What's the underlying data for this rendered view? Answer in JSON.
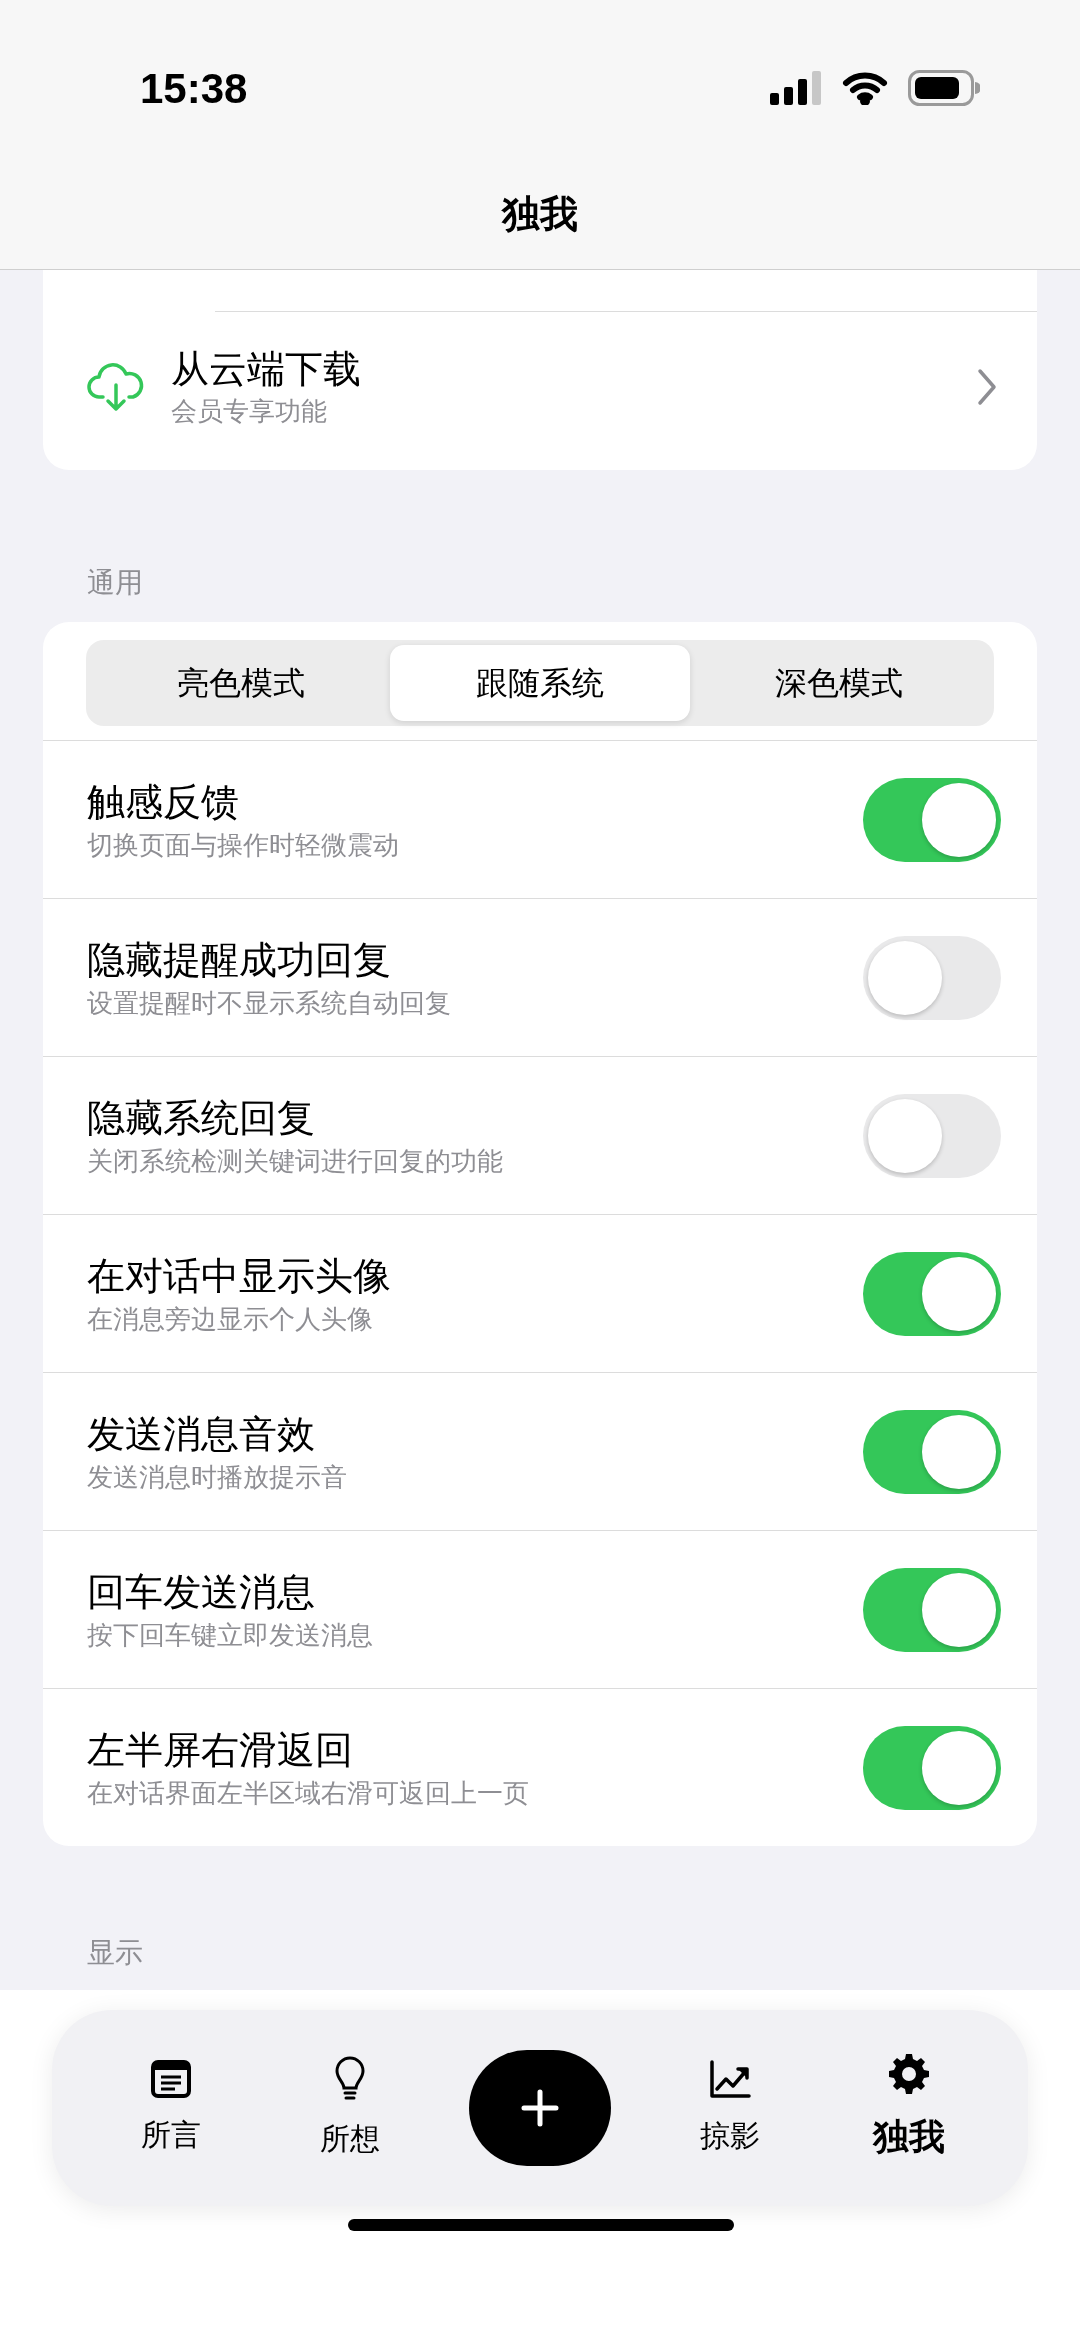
{
  "status_bar": {
    "time": "15:38"
  },
  "header": {
    "title": "独我"
  },
  "cloud_row": {
    "title": "从云端下载",
    "subtitle": "会员专享功能"
  },
  "general": {
    "label": "通用",
    "appearance": [
      {
        "label": "亮色模式",
        "selected": false
      },
      {
        "label": "跟随系统",
        "selected": true
      },
      {
        "label": "深色模式",
        "selected": false
      }
    ],
    "settings": [
      {
        "title": "触感反馈",
        "subtitle": "切换页面与操作时轻微震动",
        "on": true
      },
      {
        "title": "隐藏提醒成功回复",
        "subtitle": "设置提醒时不显示系统自动回复",
        "on": false
      },
      {
        "title": "隐藏系统回复",
        "subtitle": "关闭系统检测关键词进行回复的功能",
        "on": false
      },
      {
        "title": "在对话中显示头像",
        "subtitle": "在消息旁边显示个人头像",
        "on": true
      },
      {
        "title": "发送消息音效",
        "subtitle": "发送消息时播放提示音",
        "on": true
      },
      {
        "title": "回车发送消息",
        "subtitle": "按下回车键立即发送消息",
        "on": true
      },
      {
        "title": "左半屏右滑返回",
        "subtitle": "在对话界面左半区域右滑可返回上一页",
        "on": true
      }
    ]
  },
  "display": {
    "label": "显示"
  },
  "tab_bar": [
    {
      "kind": "doc",
      "label": "所言",
      "selected": false
    },
    {
      "kind": "bulb",
      "label": "所想",
      "selected": false
    },
    {
      "kind": "add"
    },
    {
      "kind": "chart",
      "label": "掠影",
      "selected": false
    },
    {
      "kind": "gear",
      "label": "独我",
      "selected": true
    }
  ]
}
